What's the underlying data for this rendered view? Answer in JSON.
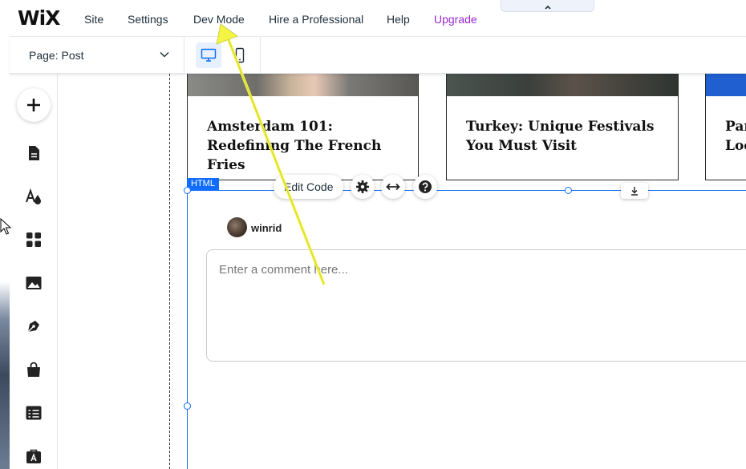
{
  "app": {
    "logo": "WiX"
  },
  "top_menu": {
    "items": [
      {
        "label": "Site"
      },
      {
        "label": "Settings"
      },
      {
        "label": "Dev Mode"
      },
      {
        "label": "Hire a Professional"
      },
      {
        "label": "Help"
      },
      {
        "label": "Upgrade"
      }
    ],
    "collapse_glyph": "^"
  },
  "page_selector": {
    "label": "Page: Post"
  },
  "view_toggles": [
    {
      "icon": "desktop-icon",
      "active": true
    },
    {
      "icon": "mobile-icon",
      "active": false
    }
  ],
  "left_toolbar": {
    "icons": [
      "add-icon",
      "pages-icon",
      "design-icon",
      "apps-icon",
      "media-icon",
      "blog-icon",
      "store-icon",
      "cms-icon",
      "business-icon"
    ]
  },
  "blog_cards": [
    {
      "title": "Amsterdam 101: Redefining The French Fries"
    },
    {
      "title": "Turkey: Unique Festivals You Must Visit"
    },
    {
      "title": "Paris Loc"
    }
  ],
  "html_element": {
    "tag": "HTML",
    "edit_code": "Edit Code",
    "tools": [
      "gear-icon",
      "stretch-icon",
      "help-icon"
    ]
  },
  "comment": {
    "username": "winrid",
    "placeholder": "Enter a comment here..."
  },
  "colors": {
    "accent": "#116dff",
    "upgrade": "#9a27d5",
    "annotation_arrow": "#f4f442"
  }
}
